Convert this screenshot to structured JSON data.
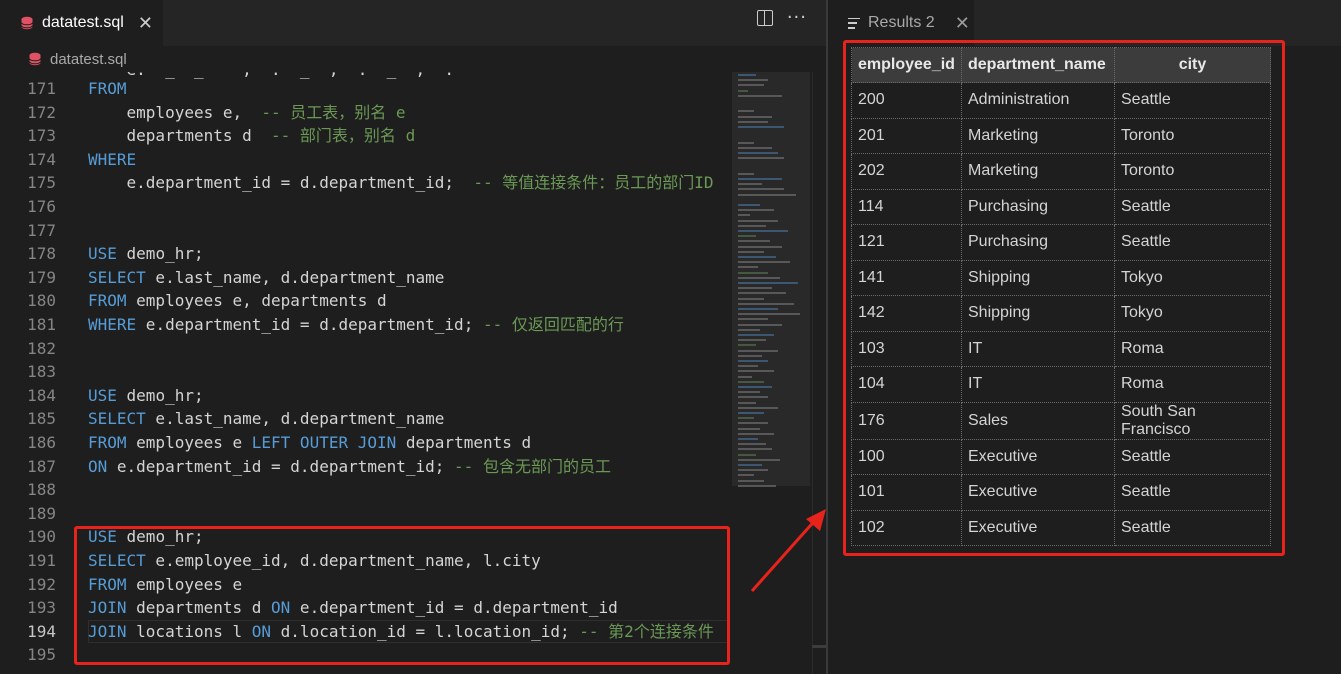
{
  "editor": {
    "tab_title": "datatest.sql",
    "tab_close": "✕",
    "more_actions": "···",
    "breadcrumb": "datatest.sql",
    "lines": [
      {
        "n": "171",
        "tokens": [
          {
            "t": "kw",
            "v": "FROM"
          }
        ]
      },
      {
        "n": "172",
        "tokens": [
          {
            "t": "tx",
            "v": "    employees e,  "
          },
          {
            "t": "cm",
            "v": "-- 员工表，别名 e"
          }
        ]
      },
      {
        "n": "173",
        "tokens": [
          {
            "t": "tx",
            "v": "    departments d  "
          },
          {
            "t": "cm",
            "v": "-- 部门表，别名 d"
          }
        ]
      },
      {
        "n": "174",
        "tokens": [
          {
            "t": "kw",
            "v": "WHERE"
          }
        ]
      },
      {
        "n": "175",
        "tokens": [
          {
            "t": "tx",
            "v": "    e.department_id = d.department_id;  "
          },
          {
            "t": "cm",
            "v": "-- 等值连接条件：员工的部门ID"
          }
        ]
      },
      {
        "n": "176",
        "tokens": []
      },
      {
        "n": "177",
        "tokens": []
      },
      {
        "n": "178",
        "tokens": [
          {
            "t": "kw",
            "v": "USE"
          },
          {
            "t": "tx",
            "v": " demo_hr;"
          }
        ]
      },
      {
        "n": "179",
        "tokens": [
          {
            "t": "kw",
            "v": "SELECT"
          },
          {
            "t": "tx",
            "v": " e.last_name, d.department_name"
          }
        ]
      },
      {
        "n": "180",
        "tokens": [
          {
            "t": "kw",
            "v": "FROM"
          },
          {
            "t": "tx",
            "v": " employees e, departments d"
          }
        ]
      },
      {
        "n": "181",
        "tokens": [
          {
            "t": "kw",
            "v": "WHERE"
          },
          {
            "t": "tx",
            "v": " e.department_id = d.department_id; "
          },
          {
            "t": "cm",
            "v": "-- 仅返回匹配的行"
          }
        ]
      },
      {
        "n": "182",
        "tokens": []
      },
      {
        "n": "183",
        "tokens": []
      },
      {
        "n": "184",
        "tokens": [
          {
            "t": "kw",
            "v": "USE"
          },
          {
            "t": "tx",
            "v": " demo_hr;"
          }
        ]
      },
      {
        "n": "185",
        "tokens": [
          {
            "t": "kw",
            "v": "SELECT"
          },
          {
            "t": "tx",
            "v": " e.last_name, d.department_name"
          }
        ]
      },
      {
        "n": "186",
        "tokens": [
          {
            "t": "kw",
            "v": "FROM"
          },
          {
            "t": "tx",
            "v": " employees e "
          },
          {
            "t": "kw",
            "v": "LEFT OUTER JOIN"
          },
          {
            "t": "tx",
            "v": " departments d"
          }
        ]
      },
      {
        "n": "187",
        "tokens": [
          {
            "t": "kw",
            "v": "ON"
          },
          {
            "t": "tx",
            "v": " e.department_id = d.department_id; "
          },
          {
            "t": "cm",
            "v": "-- 包含无部门的员工"
          }
        ]
      },
      {
        "n": "188",
        "tokens": []
      },
      {
        "n": "189",
        "tokens": []
      },
      {
        "n": "190",
        "tokens": [
          {
            "t": "kw",
            "v": "USE"
          },
          {
            "t": "tx",
            "v": " demo_hr;"
          }
        ]
      },
      {
        "n": "191",
        "tokens": [
          {
            "t": "kw",
            "v": "SELECT"
          },
          {
            "t": "tx",
            "v": " e.employee_id, d.department_name, l.city"
          }
        ]
      },
      {
        "n": "192",
        "tokens": [
          {
            "t": "kw",
            "v": "FROM"
          },
          {
            "t": "tx",
            "v": " employees e"
          }
        ]
      },
      {
        "n": "193",
        "tokens": [
          {
            "t": "kw",
            "v": "JOIN"
          },
          {
            "t": "tx",
            "v": " departments d "
          },
          {
            "t": "kw",
            "v": "ON"
          },
          {
            "t": "tx",
            "v": " e.department_id = d.department_id"
          }
        ]
      },
      {
        "n": "194",
        "tokens": [
          {
            "t": "kw",
            "v": "JOIN"
          },
          {
            "t": "tx",
            "v": " locations l "
          },
          {
            "t": "kw",
            "v": "ON"
          },
          {
            "t": "tx",
            "v": " d.location_id = l.location_id; "
          },
          {
            "t": "cm",
            "v": "-- 第2个连接条件"
          }
        ]
      },
      {
        "n": "195",
        "tokens": []
      }
    ]
  },
  "results": {
    "tab_title": "Results 2",
    "tab_close": "✕",
    "columns": [
      "employee_id",
      "department_name",
      "city"
    ],
    "rows": [
      [
        "200",
        "Administration",
        "Seattle"
      ],
      [
        "201",
        "Marketing",
        "Toronto"
      ],
      [
        "202",
        "Marketing",
        "Toronto"
      ],
      [
        "114",
        "Purchasing",
        "Seattle"
      ],
      [
        "121",
        "Purchasing",
        "Seattle"
      ],
      [
        "141",
        "Shipping",
        "Tokyo"
      ],
      [
        "142",
        "Shipping",
        "Tokyo"
      ],
      [
        "103",
        "IT",
        "Roma"
      ],
      [
        "104",
        "IT",
        "Roma"
      ],
      [
        "176",
        "Sales",
        "South San Francisco"
      ],
      [
        "100",
        "Executive",
        "Seattle"
      ],
      [
        "101",
        "Executive",
        "Seattle"
      ],
      [
        "102",
        "Executive",
        "Seattle"
      ]
    ]
  },
  "colors": {
    "keyword": "#569cd6",
    "comment": "#6a9955",
    "annotation": "#e8231c",
    "db_icon": "#e05263"
  }
}
